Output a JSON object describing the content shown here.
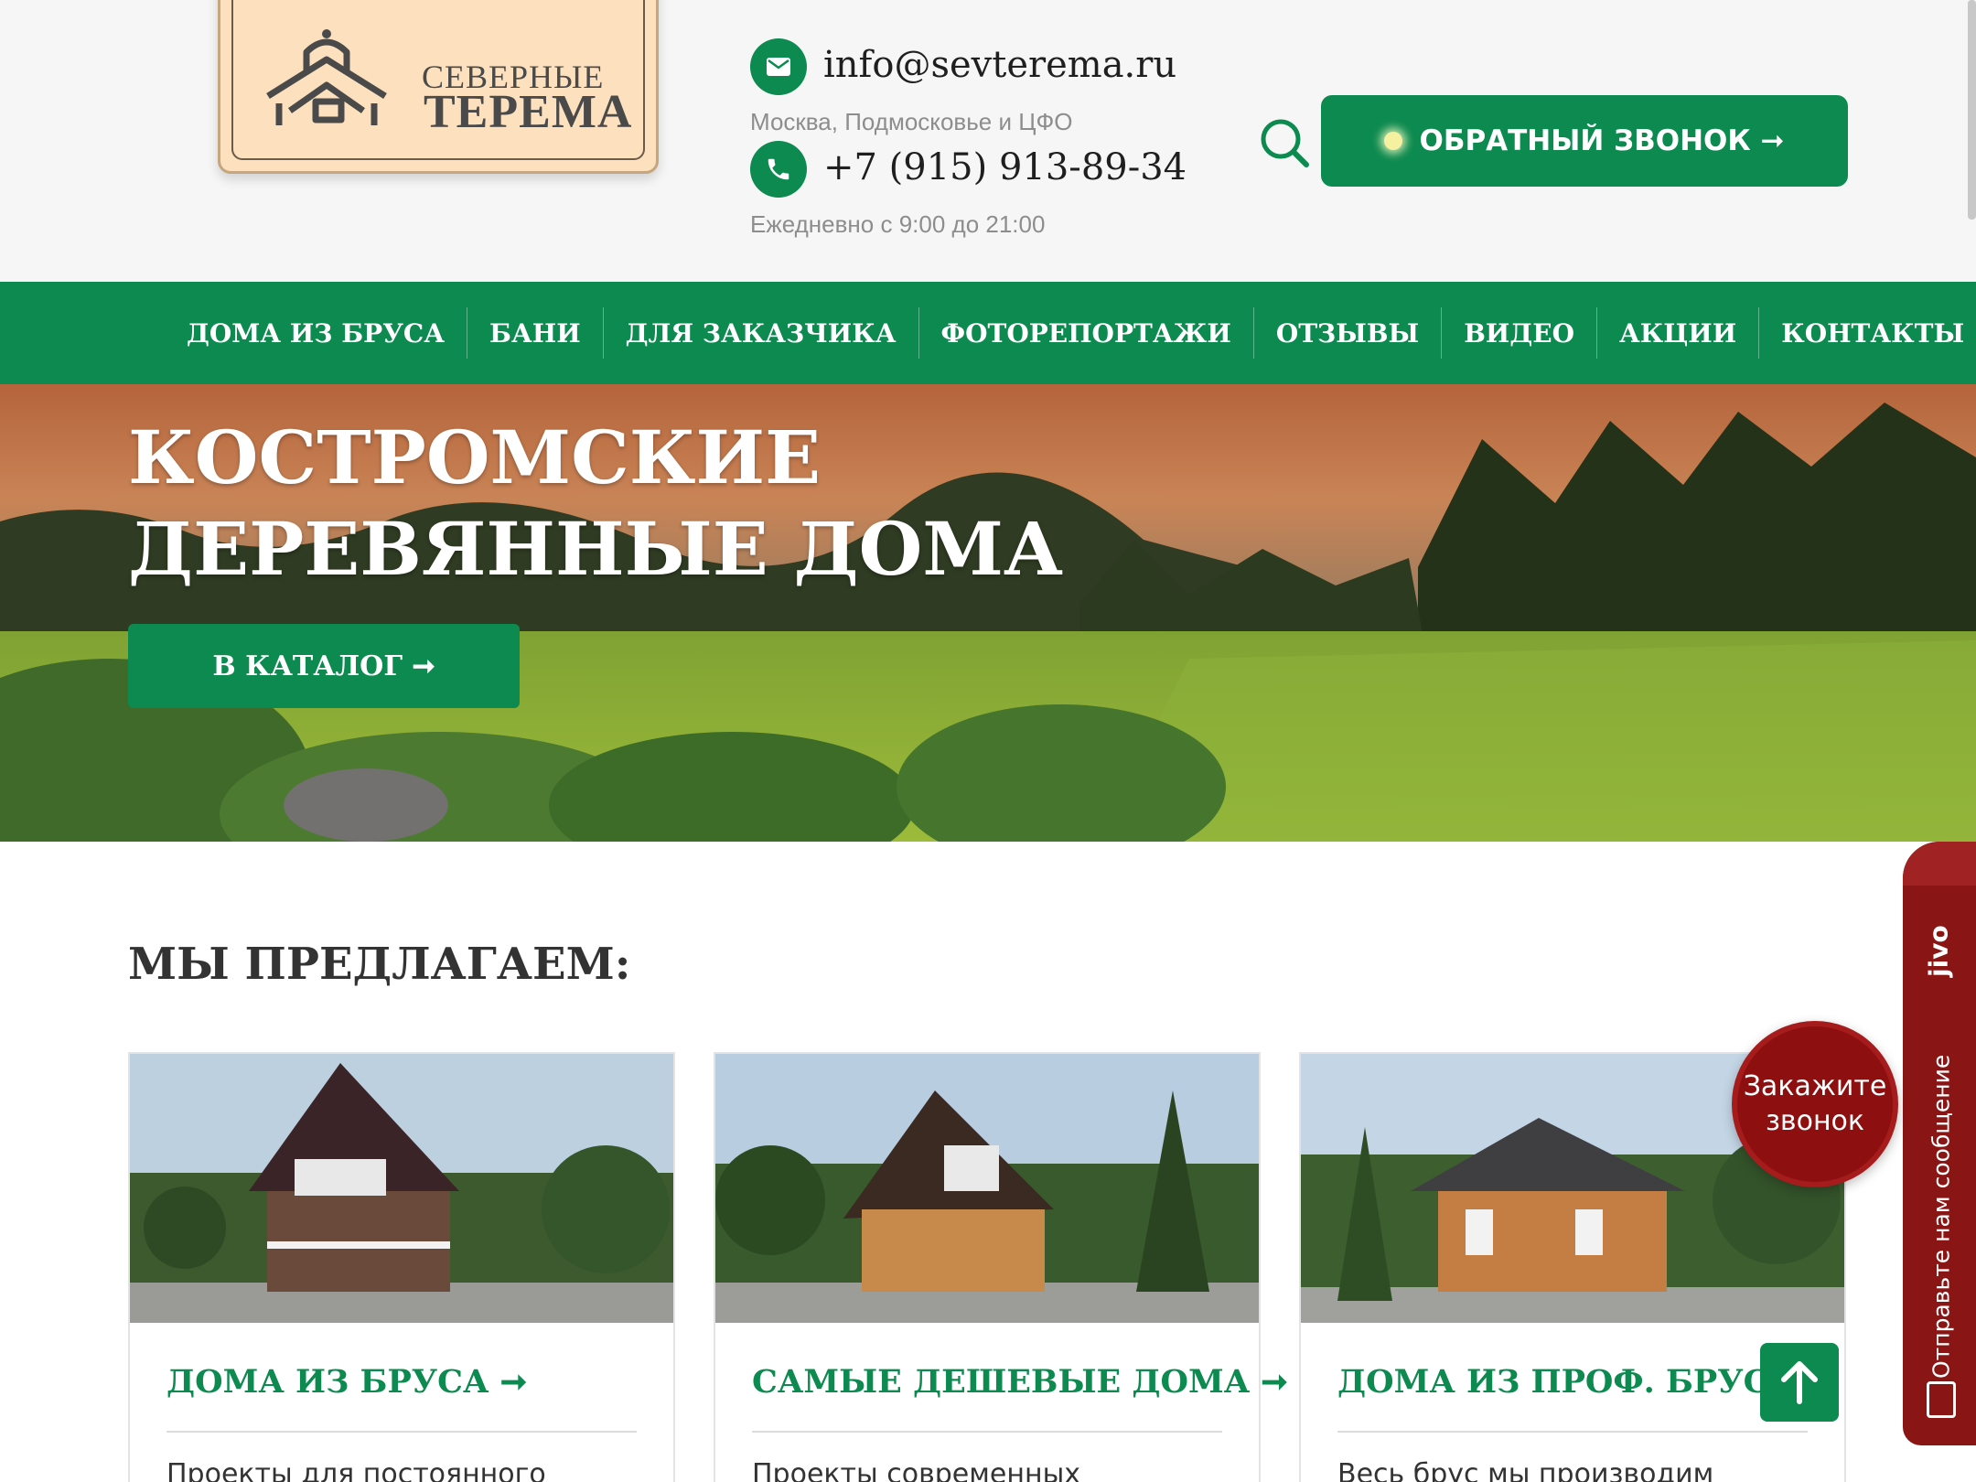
{
  "logo": {
    "line1": "СЕВЕРНЫЕ",
    "line2": "ТЕРЕМА"
  },
  "header": {
    "email": "info@sevterema.ru",
    "region": "Москва, Подмосковье и ЦФО",
    "phone": "+7 (915) 913-89-34",
    "hours": "Ежедневно с 9:00 до 21:00",
    "callback_label": "ОБРАТНЫЙ ЗВОНОК ➞"
  },
  "nav": {
    "items": [
      {
        "label": "ДОМА ИЗ БРУСА"
      },
      {
        "label": "БАНИ"
      },
      {
        "label": "ДЛЯ ЗАКАЗЧИКА"
      },
      {
        "label": "ФОТОРЕПОРТАЖИ"
      },
      {
        "label": "ОТЗЫВЫ"
      },
      {
        "label": "ВИДЕО"
      },
      {
        "label": "АКЦИИ"
      },
      {
        "label": "КОНТАКТЫ"
      }
    ]
  },
  "hero": {
    "title_line1": "КОСТРОМСКИЕ",
    "title_line2": "ДЕРЕВЯННЫЕ ДОМА",
    "catalog_label": "В КАТАЛОГ ➞"
  },
  "offers": {
    "title": "МЫ ПРЕДЛАГАЕМ:",
    "cards": [
      {
        "title": "ДОМА ИЗ БРУСА ➞",
        "text": "Проекты для постоянного"
      },
      {
        "title": "САМЫЕ ДЕШЕВЫЕ ДОМА ➞",
        "text": "Проекты современных"
      },
      {
        "title": "ДОМА ИЗ ПРОФ. БРУСА ➞",
        "text": "Весь брус мы производим"
      }
    ]
  },
  "widgets": {
    "jivo_logo": "jivo",
    "jivo_message": "Отправьте нам сообщение",
    "order_call_line1": "Закажите",
    "order_call_line2": "звонок"
  },
  "colors": {
    "brand_green": "#0c8a4f",
    "widget_red": "#8d0f10"
  }
}
